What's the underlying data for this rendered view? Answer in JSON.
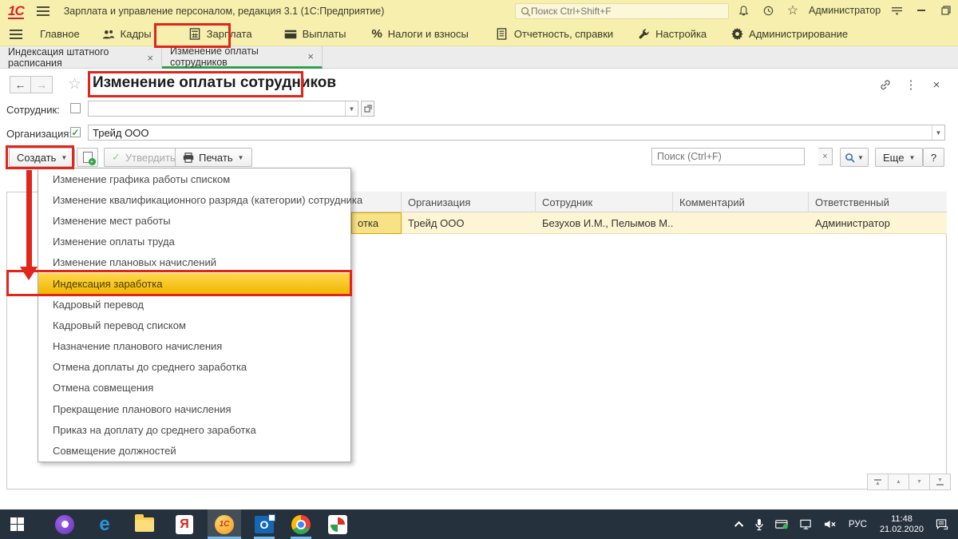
{
  "titlebar": {
    "logo": "1С",
    "app_title": "Зарплата и управление персоналом, редакция 3.1  (1С:Предприятие)",
    "search_placeholder": "Поиск Ctrl+Shift+F",
    "user": "Администратор"
  },
  "ribbon": {
    "items": [
      {
        "label": "Главное"
      },
      {
        "label": "Кадры"
      },
      {
        "label": "Зарплата",
        "highlighted": true
      },
      {
        "label": "Выплаты"
      },
      {
        "label": "Налоги и взносы",
        "icon_text": "%"
      },
      {
        "label": "Отчетность, справки"
      },
      {
        "label": "Настройка"
      },
      {
        "label": "Администрирование"
      }
    ]
  },
  "tabs": [
    {
      "label": "Индексация штатного расписания",
      "close": "×"
    },
    {
      "label": "Изменение оплаты сотрудников",
      "close": "×",
      "active": true
    }
  ],
  "document": {
    "title": "Изменение оплаты сотрудников",
    "employee_label": "Сотрудник:",
    "organization_label": "Организация:",
    "organization_value": "Трейд ООО",
    "toolbar": {
      "create_label": "Создать",
      "approve_label": "Утвердить",
      "print_label": "Печать",
      "search_placeholder": "Поиск (Ctrl+F)",
      "more_label": "Еще",
      "help_label": "?"
    }
  },
  "table": {
    "columns": [
      "Организация",
      "Сотрудник",
      "Комментарий",
      "Ответственный"
    ],
    "row": {
      "doc_fragment": "отка",
      "organization": "Трейд ООО",
      "employee": "Безухов И.М., Пелымов М...",
      "comment": "",
      "responsible": "Администратор"
    }
  },
  "create_menu": {
    "items": [
      "Изменение графика работы списком",
      "Изменение квалификационного разряда (категории) сотрудника",
      "Изменение мест работы",
      "Изменение оплаты труда",
      "Изменение плановых начислений",
      "Индексация заработка",
      "Кадровый перевод",
      "Кадровый перевод списком",
      "Назначение планового начисления",
      "Отмена доплаты до среднего заработка",
      "Отмена совмещения",
      "Прекращение планового начисления",
      "Приказ на доплату до среднего заработка",
      "Совмещение должностей"
    ],
    "highlighted_index": 5
  },
  "icons": {
    "back": "←",
    "forward": "→",
    "star_outline": "☆",
    "kebab": "⋮",
    "close": "×",
    "caret_down": "▼",
    "check": "✓",
    "up": "▲",
    "down": "▼",
    "clear_x": "×"
  },
  "taskbar": {
    "language": "РУС",
    "time": "11:48",
    "date": "21.02.2020"
  },
  "colors": {
    "accent_red": "#e1251b",
    "menu_highlight_gold": "#f5c211",
    "tab_active_green": "#2f9e4f",
    "titlebar_yellow": "#f6efad",
    "selected_row_yellow": "#fdf5d3",
    "taskbar_dark": "#26313e"
  }
}
